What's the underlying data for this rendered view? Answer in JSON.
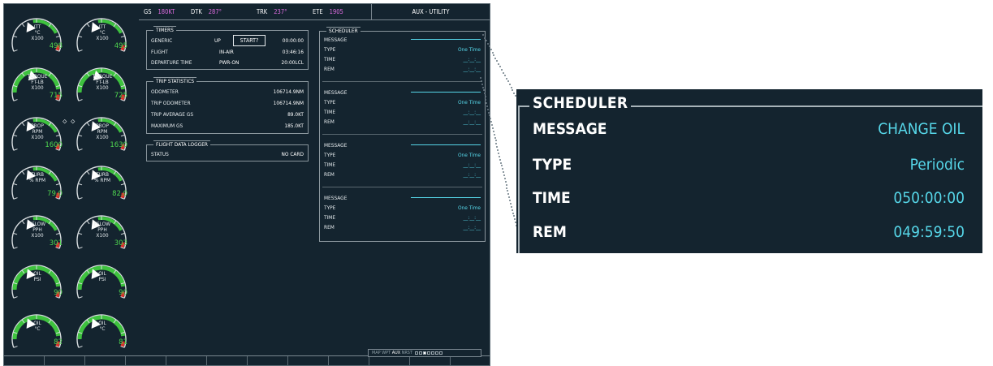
{
  "topbar": {
    "gs_label": "GS",
    "gs_value": "180KT",
    "dtk_label": "DTK",
    "dtk_value": "287°",
    "trk_label": "TRK",
    "trk_value": "237°",
    "ete_label": "ETE",
    "ete_value": "1905",
    "page_title": "AUX - UTILITY"
  },
  "gauges": [
    {
      "label1": "ITT",
      "label2": "°C",
      "label3": "X100",
      "value": "498"
    },
    {
      "label1": "ITT",
      "label2": "°C",
      "label3": "X100",
      "value": "495"
    },
    {
      "label1": "TORQUE",
      "label2": "FT-LB",
      "label3": "X100",
      "value": "715"
    },
    {
      "label1": "TORQUE",
      "label2": "FT-LB",
      "label3": "X100",
      "value": "725"
    },
    {
      "label1": "PROP",
      "label2": "RPM",
      "label3": "X100",
      "value": "1600"
    },
    {
      "label1": "PROP",
      "label2": "RPM",
      "label3": "X100",
      "value": "1630"
    },
    {
      "label1": "TURB",
      "label2": "% RPM",
      "label3": "",
      "value": "79.0"
    },
    {
      "label1": "TURB",
      "label2": "% RPM",
      "label3": "",
      "value": "82.0"
    },
    {
      "label1": "FFLOW",
      "label2": "PPH",
      "label3": "X100",
      "value": "301"
    },
    {
      "label1": "FFLOW",
      "label2": "PPH",
      "label3": "X100",
      "value": "303"
    },
    {
      "label1": "OIL",
      "label2": "PSI",
      "label3": "",
      "value": "90"
    },
    {
      "label1": "OIL",
      "label2": "PSI",
      "label3": "",
      "value": "90"
    },
    {
      "label1": "OIL",
      "label2": "°C",
      "label3": "",
      "value": "82"
    },
    {
      "label1": "OIL",
      "label2": "°C",
      "label3": "",
      "value": "81"
    }
  ],
  "timers": {
    "title": "TIMERS",
    "rows": [
      {
        "label": "GENERIC",
        "state": "UP",
        "button": "START?",
        "time": "00:00:00"
      },
      {
        "label": "FLIGHT",
        "state": "IN-AIR",
        "time": "03:46:16"
      },
      {
        "label": "DEPARTURE TIME",
        "state": "PWR-ON",
        "time": "20:00LCL"
      }
    ]
  },
  "trip": {
    "title": "TRIP STATISTICS",
    "rows": [
      {
        "label": "ODOMETER",
        "value": "106714.9NM"
      },
      {
        "label": "TRIP ODOMETER",
        "value": "106714.9NM"
      },
      {
        "label": "TRIP AVERAGE GS",
        "value": "89.0KT"
      },
      {
        "label": "MAXIMUM GS",
        "value": "185.0KT"
      }
    ]
  },
  "logger": {
    "title": "FLIGHT DATA LOGGER",
    "status_label": "STATUS",
    "status_value": "NO CARD"
  },
  "scheduler": {
    "title": "SCHEDULER",
    "labels": {
      "message": "MESSAGE",
      "type": "TYPE",
      "time": "TIME",
      "rem": "REM"
    },
    "entries": [
      {
        "type": "One Time",
        "time": "__:__:__",
        "rem": "__:__:__"
      },
      {
        "type": "One Time",
        "time": "__:__:__",
        "rem": "__:__:__"
      },
      {
        "type": "One Time",
        "time": "__:__:__",
        "rem": "__:__:__"
      },
      {
        "type": "One Time",
        "time": "__:__:__",
        "rem": "__:__:__"
      }
    ]
  },
  "page_group": {
    "items": [
      "MAP",
      "WPT",
      "AUX",
      "NRST"
    ],
    "active": "AUX"
  },
  "zoom": {
    "title": "SCHEDULER",
    "rows": [
      {
        "label": "MESSAGE",
        "value": "CHANGE OIL"
      },
      {
        "label": "TYPE",
        "value": "Periodic"
      },
      {
        "label": "TIME",
        "value": "050:00:00"
      },
      {
        "label": "REM",
        "value": "049:59:50"
      }
    ]
  },
  "colors": {
    "background": "#14242f",
    "value_green": "#4fd64f",
    "value_cyan": "#56d6e8",
    "magenta": "#e26ce3"
  }
}
